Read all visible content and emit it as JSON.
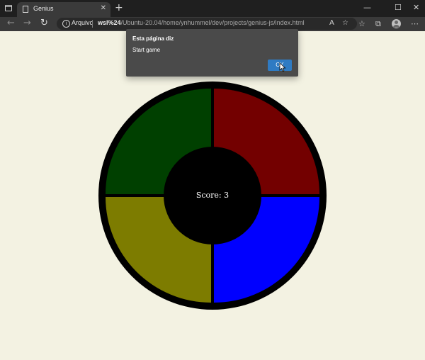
{
  "browser": {
    "tab_title": "Genius",
    "tab_close": "✕",
    "new_tab": "+",
    "window_controls": {
      "minimize": "—",
      "maximize": "☐",
      "close": "✕"
    },
    "nav": {
      "back": "←",
      "forward": "→",
      "reload": "↻"
    },
    "address": {
      "info": "i",
      "site_label": "Arquivo",
      "url_host": "wsl%24",
      "url_path": "/Ubuntu-20.04/home/ynhummel/dev/projects/genius-js/index.html"
    },
    "icons": [
      "read-aloud-icon",
      "add-favorite-icon",
      "favorites-icon",
      "collections-icon",
      "profile-avatar",
      "menu-icon"
    ]
  },
  "dialog": {
    "title": "Esta página diz",
    "message": "Start game",
    "ok_label": "OK"
  },
  "game": {
    "score_label": "Score: 3",
    "colors": {
      "green": "#004000",
      "red": "#730000",
      "yellow": "#7d7c00",
      "blue": "#0000ff",
      "background": "#f3f2e2"
    }
  }
}
